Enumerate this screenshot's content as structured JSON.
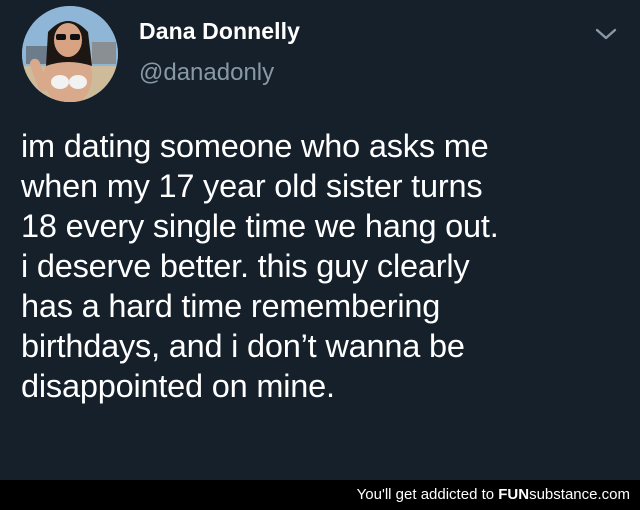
{
  "tweet": {
    "author_name": "Dana Donnelly",
    "author_handle": "@danadonly",
    "menu_icon": "chevron-down-icon",
    "text_lines": [
      "im dating someone who asks me",
      "when my 17 year old sister turns",
      "18 every single time we hang out.",
      "i deserve better. this guy clearly",
      "has a hard time remembering",
      "birthdays, and i don’t wanna be",
      "disappointed on mine."
    ]
  },
  "footer": {
    "tagline": "You'll get addicted to ",
    "brand_fun": "FUN",
    "brand_substance": "substance",
    "brand_tld": ".com"
  },
  "colors": {
    "background": "#15202b",
    "text": "#ffffff",
    "secondary_text": "#8899a6",
    "footer_background": "#000000"
  }
}
